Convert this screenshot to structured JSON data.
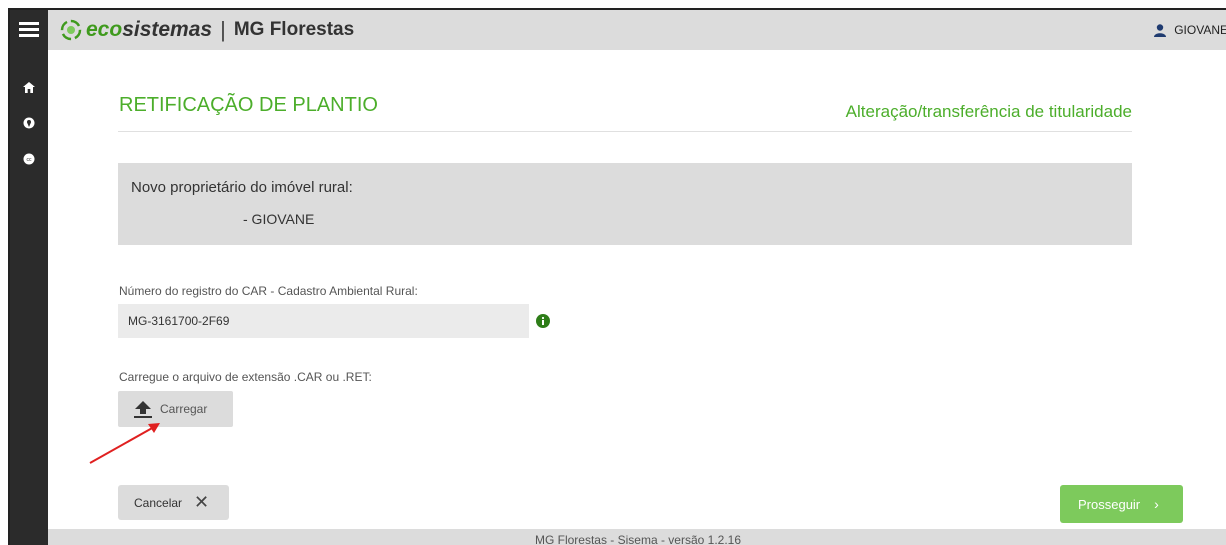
{
  "header": {
    "logo_eco": "eco",
    "logo_sistemas": "sistemas",
    "separator": "|",
    "app_name": "MG Florestas",
    "user_name": "GIOVANE"
  },
  "sidebar": {
    "icons": [
      "home-icon",
      "map-pin-icon",
      "cc-badge-icon"
    ]
  },
  "page": {
    "title": "RETIFICAÇÃO DE PLANTIO",
    "subtitle": "Alteração/transferência de titularidade"
  },
  "owner": {
    "label": "Novo proprietário do imóvel rural:",
    "name": "- GIOVANE"
  },
  "car": {
    "label": "Número do registro do CAR - Cadastro Ambiental Rural:",
    "value": "MG-3161700-2F69"
  },
  "file": {
    "label": "Carregue o arquivo de extensão .CAR ou .RET:",
    "upload_label": "Carregar"
  },
  "actions": {
    "cancel_label": "Cancelar",
    "cancel_icon": "✕",
    "proceed_label": "Prosseguir",
    "proceed_icon": "›"
  },
  "footer": {
    "text": "MG Florestas - Sisema - versão 1.2.16"
  },
  "colors": {
    "brand_green": "#4cae2b",
    "button_green": "#7dca5c",
    "sidebar_dark": "#2b2b2b",
    "annotation_red": "#e02020"
  }
}
